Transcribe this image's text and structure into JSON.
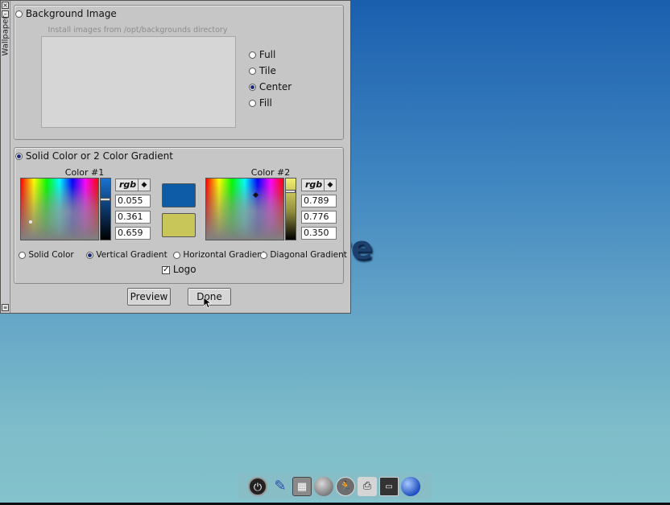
{
  "desktop": {
    "background_text": "re"
  },
  "window": {
    "title": "Wallpaper",
    "close_glyph": "×",
    "minimize_glyph": "–",
    "background_image": {
      "label": "Background Image",
      "selected": false,
      "hint": "Install images from /opt/backgrounds directory",
      "modes": [
        {
          "label": "Full",
          "selected": false
        },
        {
          "label": "Tile",
          "selected": false
        },
        {
          "label": "Center",
          "selected": true
        },
        {
          "label": "Fill",
          "selected": false
        }
      ]
    },
    "solid_color": {
      "label": "Solid Color or 2 Color Gradient",
      "selected": true,
      "color1": {
        "title": "Color #1",
        "mode": "rgb",
        "values": [
          "0.055",
          "0.361",
          "0.659"
        ],
        "hex": "#0e5ca8"
      },
      "color2": {
        "title": "Color #2",
        "mode": "rgb",
        "values": [
          "0.789",
          "0.776",
          "0.350"
        ],
        "hex": "#c9c659"
      },
      "gradient_options": [
        {
          "label": "Solid Color",
          "selected": false
        },
        {
          "label": "Vertical Gradient",
          "selected": true
        },
        {
          "label": "Horizontal Gradient",
          "selected": false
        },
        {
          "label": "Diagonal Gradient",
          "selected": false
        }
      ],
      "logo": {
        "label": "Logo",
        "checked": true
      }
    },
    "buttons": {
      "preview": "Preview",
      "done": "Done"
    }
  },
  "dock": {
    "icons": [
      "power-icon",
      "paintbrush-icon",
      "settings-grid-icon",
      "disk-icon",
      "runner-icon",
      "printer-icon",
      "terminal-icon",
      "globe-icon"
    ]
  }
}
